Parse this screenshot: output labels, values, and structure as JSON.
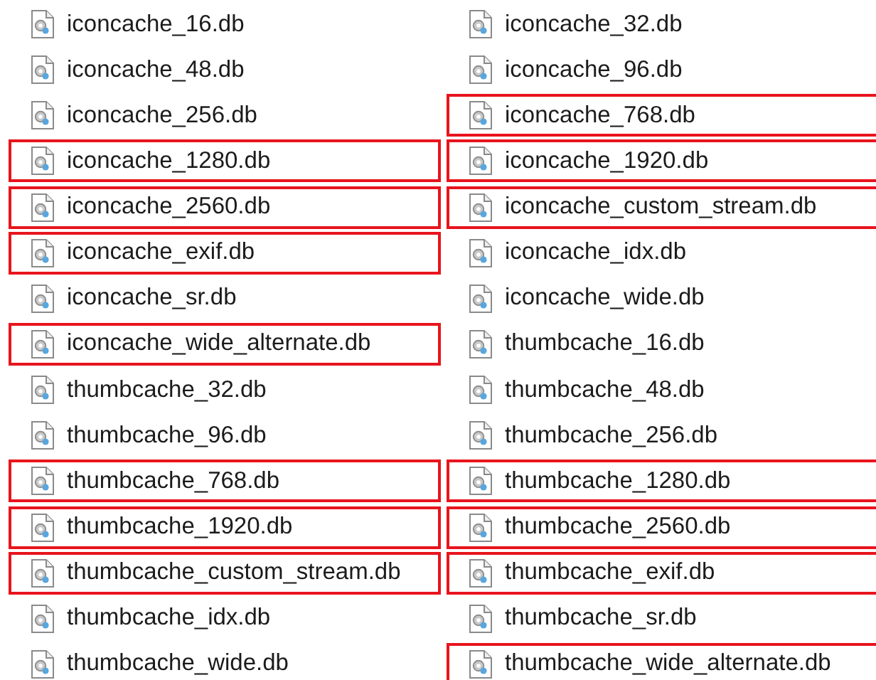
{
  "files": [
    {
      "name": "iconcache_16.db",
      "highlighted": false
    },
    {
      "name": "iconcache_32.db",
      "highlighted": false
    },
    {
      "name": "iconcache_48.db",
      "highlighted": false
    },
    {
      "name": "iconcache_96.db",
      "highlighted": false
    },
    {
      "name": "iconcache_256.db",
      "highlighted": false
    },
    {
      "name": "iconcache_768.db",
      "highlighted": true
    },
    {
      "name": "iconcache_1280.db",
      "highlighted": true
    },
    {
      "name": "iconcache_1920.db",
      "highlighted": true
    },
    {
      "name": "iconcache_2560.db",
      "highlighted": true
    },
    {
      "name": "iconcache_custom_stream.db",
      "highlighted": true
    },
    {
      "name": "iconcache_exif.db",
      "highlighted": true
    },
    {
      "name": "iconcache_idx.db",
      "highlighted": false
    },
    {
      "name": "iconcache_sr.db",
      "highlighted": false
    },
    {
      "name": "iconcache_wide.db",
      "highlighted": false
    },
    {
      "name": "iconcache_wide_alternate.db",
      "highlighted": true
    },
    {
      "name": "thumbcache_16.db",
      "highlighted": false
    },
    {
      "name": "thumbcache_32.db",
      "highlighted": false
    },
    {
      "name": "thumbcache_48.db",
      "highlighted": false
    },
    {
      "name": "thumbcache_96.db",
      "highlighted": false
    },
    {
      "name": "thumbcache_256.db",
      "highlighted": false
    },
    {
      "name": "thumbcache_768.db",
      "highlighted": true
    },
    {
      "name": "thumbcache_1280.db",
      "highlighted": true
    },
    {
      "name": "thumbcache_1920.db",
      "highlighted": true
    },
    {
      "name": "thumbcache_2560.db",
      "highlighted": true
    },
    {
      "name": "thumbcache_custom_stream.db",
      "highlighted": true
    },
    {
      "name": "thumbcache_exif.db",
      "highlighted": true
    },
    {
      "name": "thumbcache_idx.db",
      "highlighted": false
    },
    {
      "name": "thumbcache_sr.db",
      "highlighted": false
    },
    {
      "name": "thumbcache_wide.db",
      "highlighted": false
    },
    {
      "name": "thumbcache_wide_alternate.db",
      "highlighted": true
    }
  ]
}
